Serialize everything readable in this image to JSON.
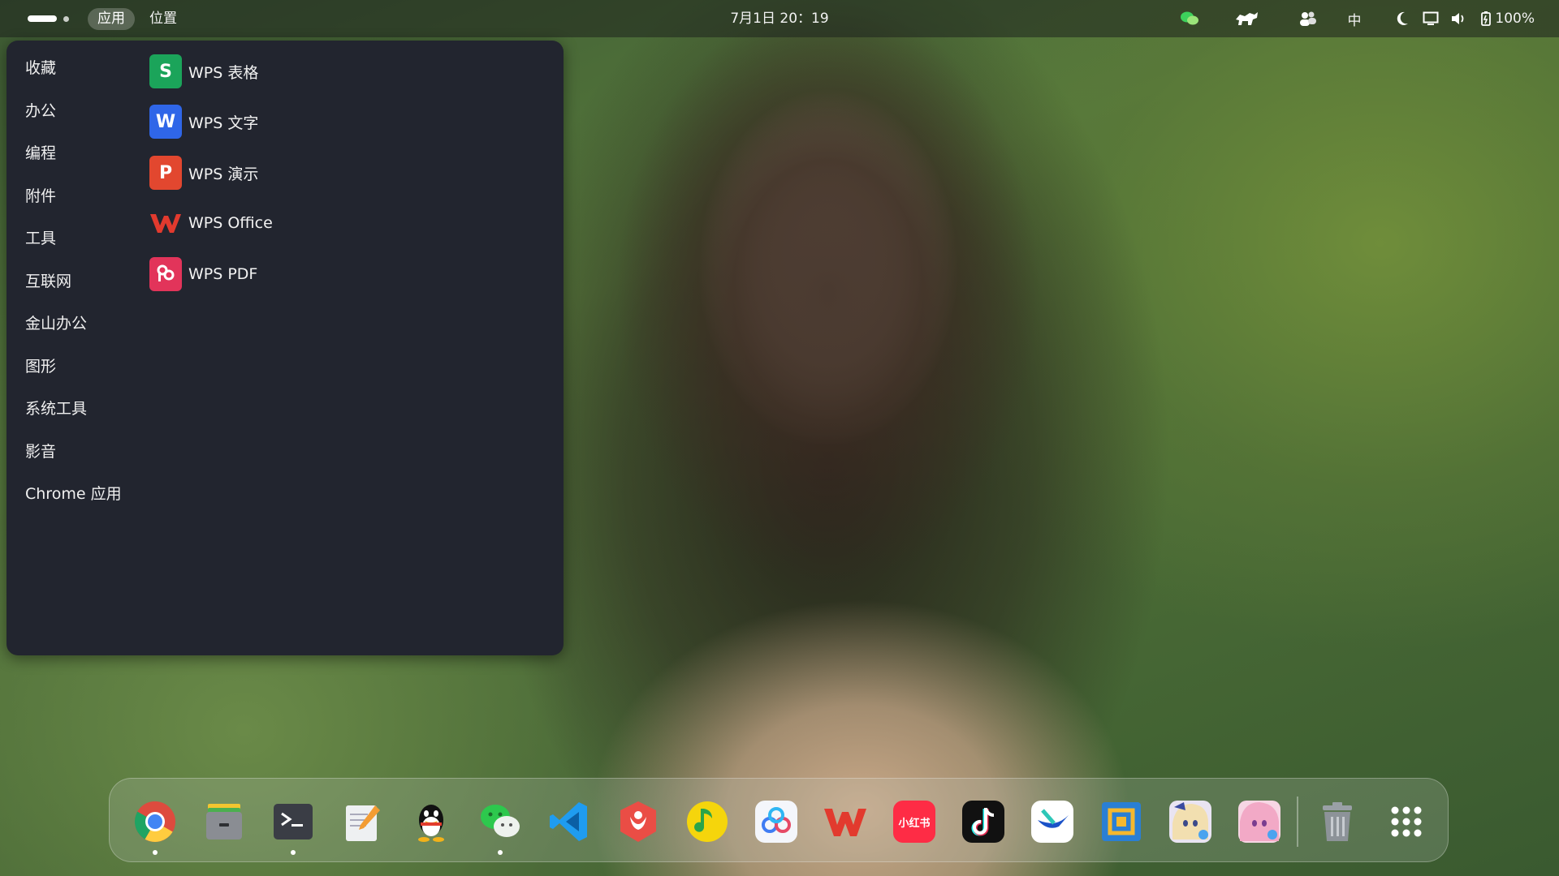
{
  "topbar": {
    "menu_apps": "应用",
    "menu_places": "位置",
    "clock": "7月1日 20：19",
    "input_method": "中",
    "battery_percent": "100%",
    "tray_icons": [
      "wechat-icon",
      "cat-icon",
      "people-icon",
      "moon-icon",
      "display-icon",
      "volume-icon",
      "battery-icon"
    ]
  },
  "app_menu": {
    "categories": [
      "收藏",
      "办公",
      "编程",
      "附件",
      "工具",
      "互联网",
      "金山办公",
      "图形",
      "系统工具",
      "影音",
      "Chrome 应用"
    ],
    "apps": [
      {
        "label": "WPS 表格",
        "icon": "wps-spreadsheet-icon",
        "letter": "S",
        "color": "#1ba45a"
      },
      {
        "label": "WPS 文字",
        "icon": "wps-writer-icon",
        "letter": "W",
        "color": "#2f66e8"
      },
      {
        "label": "WPS 演示",
        "icon": "wps-presentation-icon",
        "letter": "P",
        "color": "#e2472f"
      },
      {
        "label": "WPS Office",
        "icon": "wps-office-icon",
        "letter": "",
        "color": "#e23a2e"
      },
      {
        "label": "WPS PDF",
        "icon": "wps-pdf-icon",
        "letter": "",
        "color": "#e2345a"
      }
    ]
  },
  "dock": {
    "items": [
      {
        "name": "chrome-icon",
        "running": true
      },
      {
        "name": "file-manager-icon",
        "running": false
      },
      {
        "name": "terminal-icon",
        "running": true
      },
      {
        "name": "text-editor-icon",
        "running": false
      },
      {
        "name": "qq-icon",
        "running": false
      },
      {
        "name": "wechat-icon",
        "running": true
      },
      {
        "name": "vscode-icon",
        "running": false
      },
      {
        "name": "security-shield-icon",
        "running": false
      },
      {
        "name": "music-icon",
        "running": false
      },
      {
        "name": "baidu-netdisk-icon",
        "running": false
      },
      {
        "name": "wps-office-icon",
        "running": false
      },
      {
        "name": "xiaohongshu-icon",
        "running": false
      },
      {
        "name": "tiktok-icon",
        "running": false
      },
      {
        "name": "feishu-icon",
        "running": false
      },
      {
        "name": "remote-desktop-icon",
        "running": false
      },
      {
        "name": "game-anime-icon",
        "running": false
      },
      {
        "name": "game-anime-pink-icon",
        "running": false
      },
      {
        "name": "trash-icon",
        "running": false
      },
      {
        "name": "app-grid-icon",
        "running": false
      }
    ],
    "xiaohongshu_text": "小红书"
  }
}
